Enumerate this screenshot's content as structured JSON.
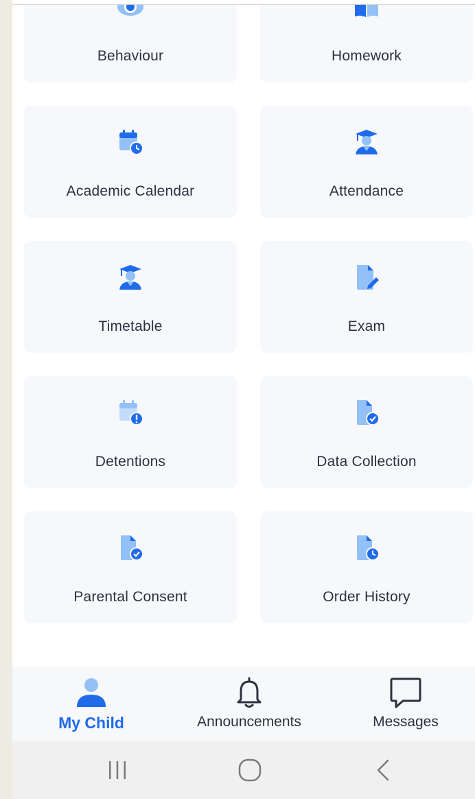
{
  "colors": {
    "accent": "#1f6bea",
    "icon_blue": "#3b82f6",
    "icon_light": "#93c0f7",
    "tile_bg": "#f6f8fb",
    "text": "#2c3240"
  },
  "tiles": [
    {
      "label": "Behaviour",
      "icon": "eye-icon"
    },
    {
      "label": "Homework",
      "icon": "book-icon"
    },
    {
      "label": "Academic Calendar",
      "icon": "calendar-clock-icon"
    },
    {
      "label": "Attendance",
      "icon": "student-graduate-icon"
    },
    {
      "label": "Timetable",
      "icon": "student-graduate-icon"
    },
    {
      "label": "Exam",
      "icon": "document-pen-icon"
    },
    {
      "label": "Detentions",
      "icon": "calendar-alert-icon"
    },
    {
      "label": "Data Collection",
      "icon": "document-check-icon"
    },
    {
      "label": "Parental Consent",
      "icon": "document-check-icon"
    },
    {
      "label": "Order History",
      "icon": "document-clock-icon"
    }
  ],
  "bottom_nav": {
    "items": [
      {
        "label": "My Child",
        "icon": "person-icon",
        "active": true
      },
      {
        "label": "Announcements",
        "icon": "bell-icon",
        "active": false
      },
      {
        "label": "Messages",
        "icon": "chat-bubble-icon",
        "active": false
      }
    ]
  },
  "system_nav": {
    "recent": "recent-apps-icon",
    "home": "home-circle-icon",
    "back": "back-chevron-icon"
  }
}
